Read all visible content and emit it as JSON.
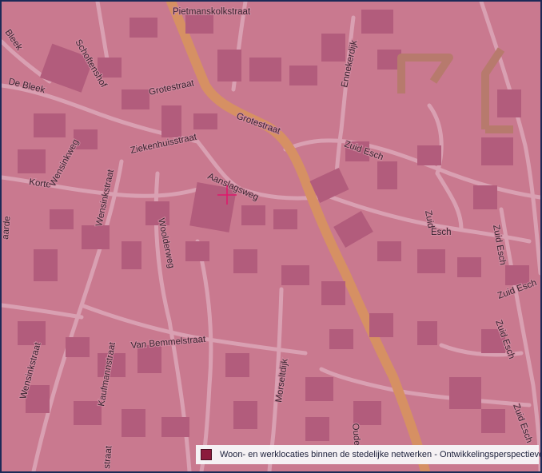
{
  "map": {
    "overlay_color": "#c9798f",
    "road_color": "#d9a0b2",
    "building_color": "#b25c7c",
    "main_road_color": "#d69063",
    "streets": [
      "Pietmanskolkstraat",
      "Grotestraat",
      "Grotestraat",
      "Ziekenhuisstraat",
      "Aanslagsweg",
      "Zuid Esch",
      "Zuid",
      "Esch",
      "Zuid Esch",
      "Zuid Esch",
      "Zuid Esch",
      "Zuid Esch",
      "Ennekerdijk",
      "Schoftenshof",
      "De Bleek",
      "Bleek",
      "Korte",
      "Wensinkweg",
      "Wensinkstraat",
      "Wensinkstraat",
      "Woolderweg",
      "Van Bemmelstraat",
      "Kaufmannstraat",
      "Morseltdijk",
      "Oude",
      "aarde",
      "straat"
    ]
  },
  "legend": {
    "swatch_color": "#8b1a3c",
    "label": "Woon- en werklocaties binnen de stedelijke netwerken - Ontwikkelingsperspectieven"
  },
  "crosshair": {
    "color": "#e0186c"
  }
}
